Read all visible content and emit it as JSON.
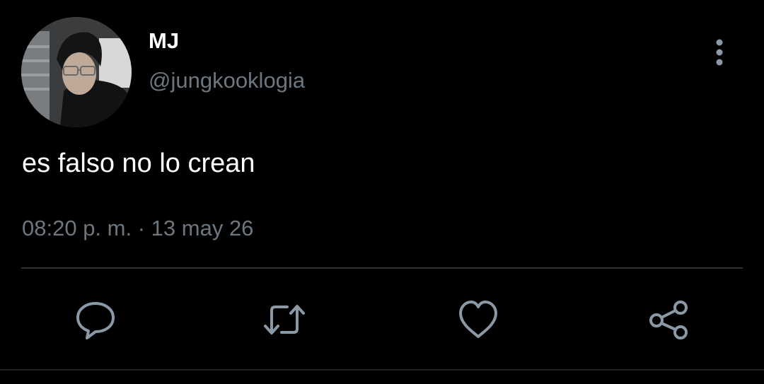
{
  "tweet": {
    "display_name": "MJ",
    "handle": "@jungkooklogia",
    "text": "es falso no lo crean",
    "time": "08:20 p. m.",
    "separator": "·",
    "date": "13 may 26"
  },
  "actions": {
    "reply_icon": "comment-icon",
    "retweet_icon": "retweet-icon",
    "like_icon": "heart-icon",
    "share_icon": "share-icon",
    "more_icon": "more-vertical-icon"
  },
  "colors": {
    "background": "#000000",
    "primary_text": "#ffffff",
    "secondary_text": "#6e767d",
    "icon": "#8b98a5",
    "divider": "#2f3336"
  }
}
